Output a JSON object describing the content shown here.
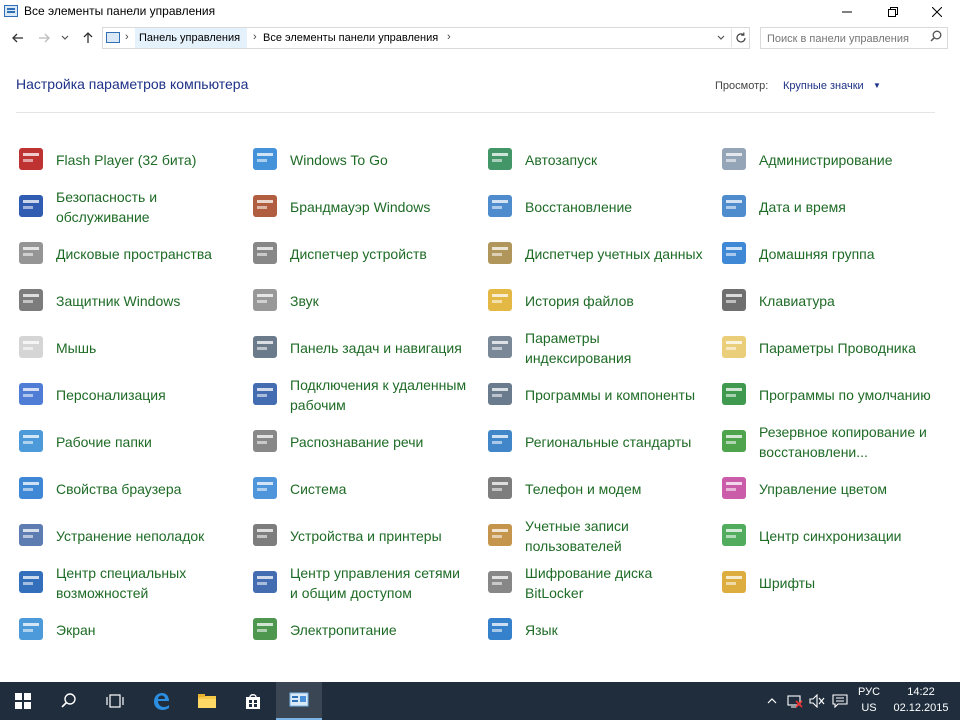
{
  "window": {
    "title": "Все элементы панели управления"
  },
  "address": {
    "crumbs": [
      "Панель управления",
      "Все элементы панели управления"
    ],
    "search_placeholder": "Поиск в панели управления"
  },
  "page": {
    "heading": "Настройка параметров компьютера",
    "view_label": "Просмотр:",
    "view_value": "Крупные значки"
  },
  "items": [
    [
      "Flash Player (32 бита)",
      "Безопасность и обслуживание",
      "Дисковые пространства",
      "Защитник Windows",
      "Мышь",
      "Персонализация",
      "Рабочие папки",
      "Свойства браузера",
      "Устранение неполадок",
      "Центр специальных возможностей",
      "Экран"
    ],
    [
      "Windows To Go",
      "Брандмауэр Windows",
      "Диспетчер устройств",
      "Звук",
      "Панель задач и навигация",
      "Подключения к удаленным рабочим",
      "Распознавание речи",
      "Система",
      "Устройства и принтеры",
      "Центр управления сетями и общим доступом",
      "Электропитание"
    ],
    [
      "Автозапуск",
      "Восстановление",
      "Диспетчер учетных данных",
      "История файлов",
      "Параметры индексирования",
      "Программы и компоненты",
      "Региональные стандарты",
      "Телефон и модем",
      "Учетные записи пользователей",
      "Шифрование диска BitLocker",
      "Язык"
    ],
    [
      "Администрирование",
      "Дата и время",
      "Домашняя группа",
      "Клавиатура",
      "Параметры Проводника",
      "Программы по умолчанию",
      "Резервное копирование и восстановлени...",
      "Управление цветом",
      "Центр синхронизации",
      "Шрифты"
    ]
  ],
  "tray": {
    "lang_top": "РУС",
    "lang_bottom": "US",
    "time": "14:22",
    "date": "02.12.2015"
  }
}
